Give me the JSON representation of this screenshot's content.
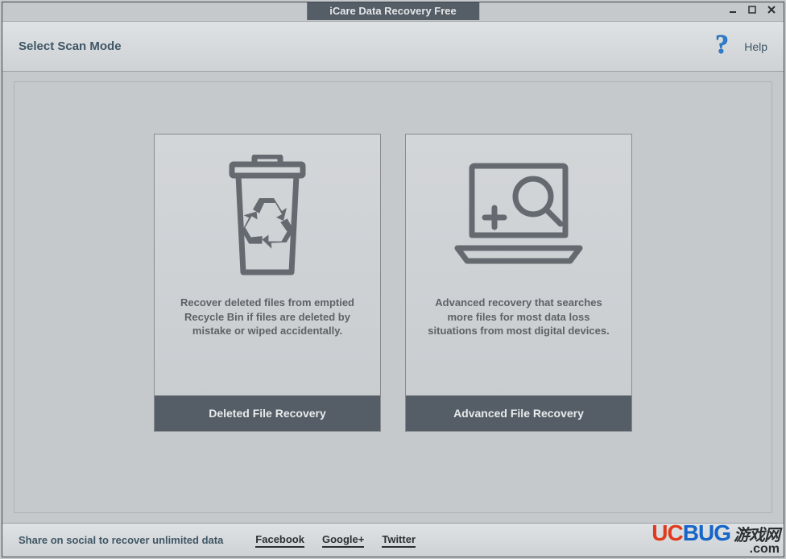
{
  "window": {
    "title": "iCare Data Recovery Free"
  },
  "header": {
    "title": "Select Scan Mode",
    "help_label": "Help"
  },
  "cards": [
    {
      "icon": "recycle-bin-icon",
      "description": "Recover deleted files from emptied Recycle Bin if files are deleted by mistake or wiped accidentally.",
      "button_label": "Deleted File Recovery"
    },
    {
      "icon": "laptop-search-icon",
      "description": "Advanced recovery that searches more files for most data loss situations from most digital devices.",
      "button_label": "Advanced File Recovery"
    }
  ],
  "footer": {
    "share_text": "Share on social to recover unlimited data",
    "social": [
      "Facebook",
      "Google+",
      "Twitter"
    ]
  },
  "watermark": {
    "brand_chars": [
      "U",
      "C",
      "B",
      "U",
      "G"
    ],
    "cn": "游戏网",
    "dotcom": ".com"
  }
}
